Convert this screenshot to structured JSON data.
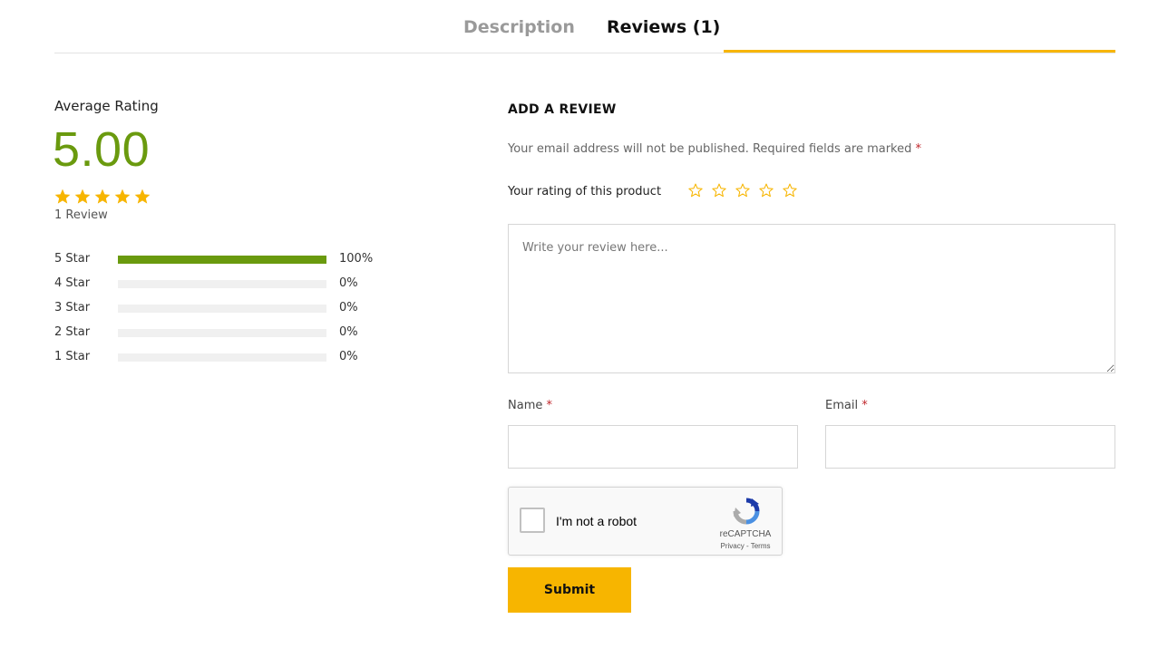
{
  "tabs": {
    "description": "Description",
    "reviews": "Reviews (1)",
    "active": "reviews"
  },
  "summary": {
    "average_label": "Average Rating",
    "average_value": "5.00",
    "stars_filled": 5,
    "review_count": "1 Review",
    "distribution": [
      {
        "label": "5 Star",
        "percent": 100,
        "percent_text": "100%"
      },
      {
        "label": "4 Star",
        "percent": 0,
        "percent_text": "0%"
      },
      {
        "label": "3 Star",
        "percent": 0,
        "percent_text": "0%"
      },
      {
        "label": "2 Star",
        "percent": 0,
        "percent_text": "0%"
      },
      {
        "label": "1 Star",
        "percent": 0,
        "percent_text": "0%"
      }
    ]
  },
  "form": {
    "title": "ADD A REVIEW",
    "note": "Your email address will not be published. Required fields are marked",
    "required_mark": "*",
    "rating_label": "Your rating of this product",
    "review_placeholder": "Write your review here...",
    "name_label": "Name",
    "email_label": "Email",
    "captcha_text": "I'm not a robot",
    "captcha_brand": "reCAPTCHA",
    "captcha_links": "Privacy - Terms",
    "submit_label": "Submit"
  },
  "colors": {
    "accent": "#f7b500",
    "rating_green": "#6a9a0e",
    "required_red": "#c0262b"
  }
}
